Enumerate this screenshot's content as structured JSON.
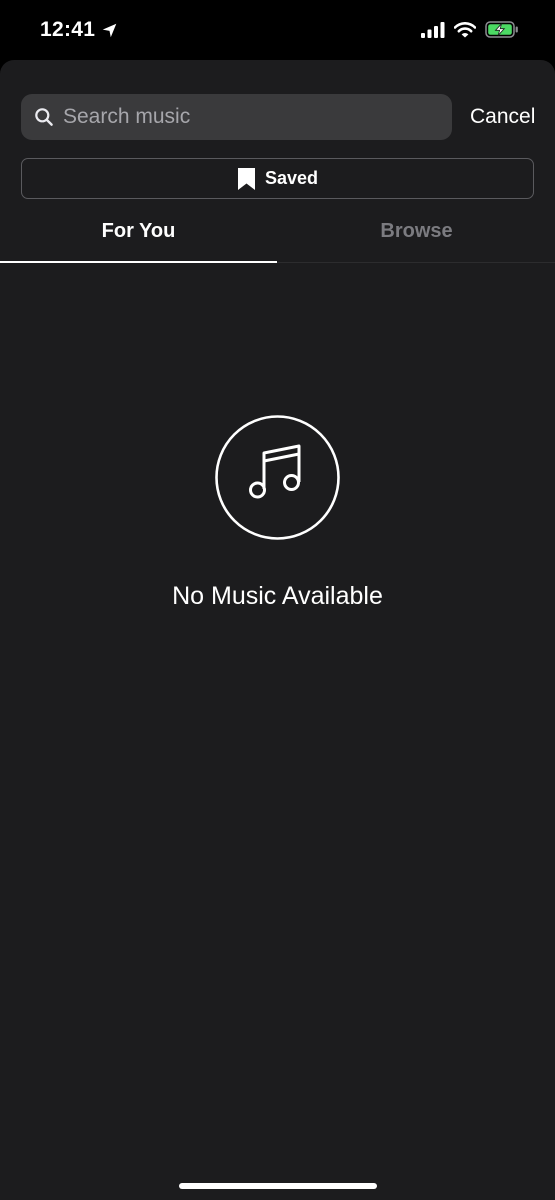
{
  "status_bar": {
    "time": "12:41",
    "icons": [
      "location-arrow-icon",
      "cellular-signal-icon",
      "wifi-icon",
      "battery-charging-icon"
    ],
    "battery_color": "#4cd964"
  },
  "search": {
    "placeholder": "Search music",
    "value": "",
    "cancel_label": "Cancel"
  },
  "saved": {
    "label": "Saved",
    "icon": "bookmark-icon"
  },
  "tabs": [
    {
      "label": "For You",
      "active": true
    },
    {
      "label": "Browse",
      "active": false
    }
  ],
  "empty_state": {
    "icon": "music-note-icon",
    "message": "No Music Available"
  },
  "colors": {
    "background": "#1c1c1e",
    "search_field": "#3a3a3c",
    "inactive_tab": "#7b7b80",
    "text": "#ffffff"
  }
}
